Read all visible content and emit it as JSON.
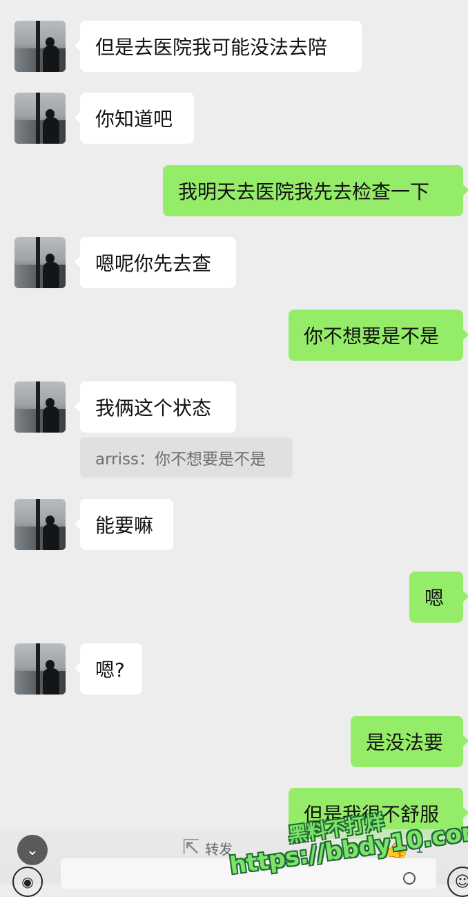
{
  "messages": [
    {
      "side": "in",
      "text": "但是去医院我可能没法去陪"
    },
    {
      "side": "in",
      "text": "你知道吧"
    },
    {
      "side": "out",
      "text": "我明天去医院我先去检查一下"
    },
    {
      "side": "in",
      "text": "嗯呢你先去查"
    },
    {
      "side": "out",
      "text": "你不想要是不是"
    },
    {
      "side": "in",
      "text": "我俩这个状态",
      "quote": "arriss：你不想要是不是"
    },
    {
      "side": "in",
      "text": "能要嘛"
    },
    {
      "side": "out",
      "text": "嗯"
    },
    {
      "side": "in",
      "text": "嗯?"
    },
    {
      "side": "out",
      "text": "是没法要"
    },
    {
      "side": "out",
      "text": "但是我很不舒服"
    }
  ],
  "toolbar": {
    "collapse_icon": "chevron-down-icon",
    "forward_label": "转发",
    "forward_icon": "share-icon",
    "like_icon": "thumbs-up-icon",
    "like_count": "1"
  },
  "input": {
    "voice_icon": "voice-icon",
    "mic_icon": "microphone-icon",
    "emoji_icon": "emoji-icon"
  },
  "watermark": {
    "line1": "黑料不打烊",
    "line2": "https://bbdy10.com"
  },
  "colors": {
    "background": "#ededed",
    "incoming_bubble": "#ffffff",
    "outgoing_bubble": "#95ec69",
    "quote_bubble": "#e0e0e0",
    "watermark_fill": "#7fe36a"
  }
}
